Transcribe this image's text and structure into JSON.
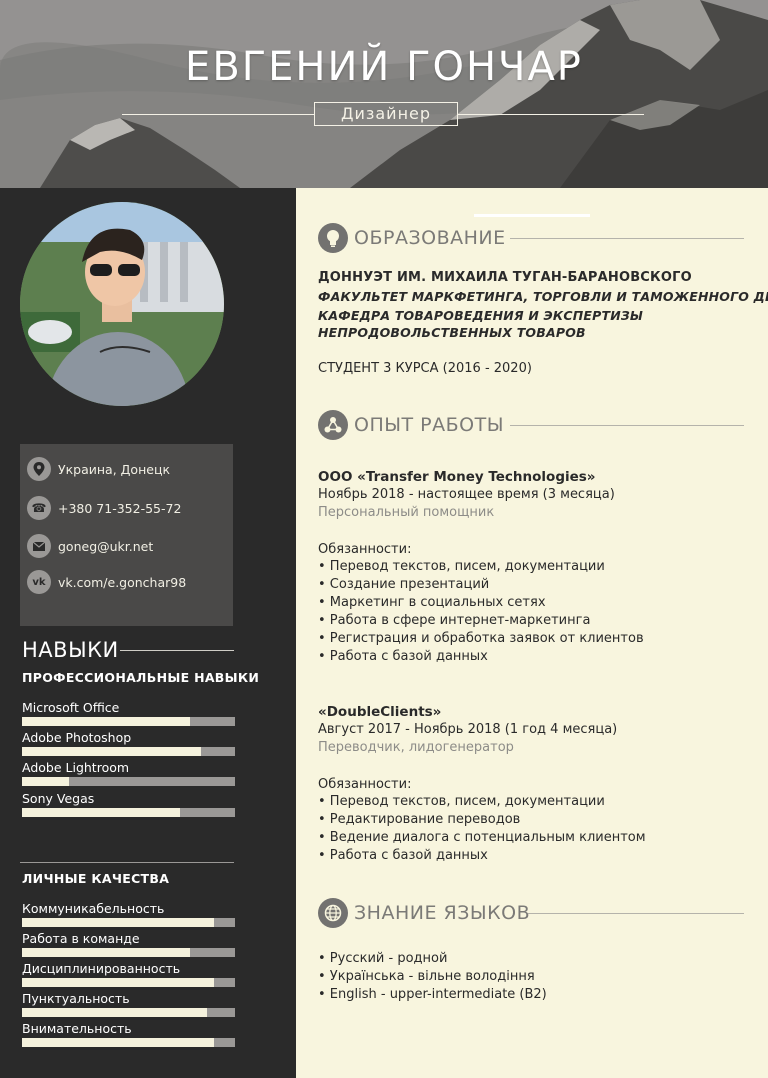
{
  "header": {
    "name": "ЕВГЕНИЙ ГОНЧАР",
    "role": "Дизайнер"
  },
  "contacts": [
    {
      "icon": "location-pin-icon",
      "text": "Украина, Донецк"
    },
    {
      "icon": "phone-icon",
      "text": "+380 71-352-55-72"
    },
    {
      "icon": "mail-icon",
      "text": "goneg@ukr.net"
    },
    {
      "icon": "vk-icon",
      "text": "vk.com/e.gonchar98"
    }
  ],
  "skills": {
    "title": "НАВЫКИ",
    "professional_title": "ПРОФЕССИОНАЛЬНЫЕ НАВЫКИ",
    "professional": [
      {
        "label": "Microsoft Office",
        "level": 0.79
      },
      {
        "label": "Adobe Photoshop",
        "level": 0.84
      },
      {
        "label": "Adobe Lightroom",
        "level": 0.22
      },
      {
        "label": "Sony Vegas",
        "level": 0.74
      }
    ],
    "personal_title": "ЛИЧНЫЕ КАЧЕСТВА",
    "personal": [
      {
        "label": "Коммуникабельность",
        "level": 0.9
      },
      {
        "label": "Работа в команде",
        "level": 0.79
      },
      {
        "label": "Дисциплинированность",
        "level": 0.9
      },
      {
        "label": "Пунктуальность",
        "level": 0.87
      },
      {
        "label": "Внимательность",
        "level": 0.9
      }
    ]
  },
  "education": {
    "title": "ОБРАЗОВАНИЕ",
    "university": "ДОННУЭТ ИМ. МИХАИЛА ТУГАН-БАРАНОВСКОГО",
    "faculty": "ФАКУЛЬТЕТ МАРКФЕТИНГА, ТОРГОВЛИ И ТАМОЖЕННОГО ДЕЛА",
    "department_line1": "КАФЕДРА ТОВАРОВЕДЕНИЯ И ЭКСПЕРТИЗЫ",
    "department_line2": "НЕПРОДОВОЛЬСТВЕННЫХ ТОВАРОВ",
    "status": "СТУДЕНТ 3 КУРСА (2016 - 2020)"
  },
  "experience": {
    "title": "ОПЫТ РАБОТЫ",
    "jobs": [
      {
        "company": "ООО «Transfer Money Technologies»",
        "period": "Ноябрь 2018 - настоящее время (3 месяца)",
        "position": "Персональный помощник",
        "duties_title": "Обязанности:",
        "duties": [
          "• Перевод текстов, писем, документации",
          "• Создание презентаций",
          "• Маркетинг в социальных сетях",
          "• Работа в сфере интернет-маркетинга",
          "• Регистрация и обработка заявок от клиентов",
          "• Работа с базой данных"
        ]
      },
      {
        "company": "«DoubleClients»",
        "period": "Август 2017 - Ноябрь 2018 (1 год 4 месяца)",
        "position": "Переводчик, лидогенератор",
        "duties_title": "Обязанности:",
        "duties": [
          "• Перевод текстов, писем, документации",
          "• Редактирование переводов",
          "• Ведение диалога с потенциальным клиентом",
          "• Работа с базой данных"
        ]
      }
    ]
  },
  "languages": {
    "title": "ЗНАНИЕ ЯЗЫКОВ",
    "items": [
      "• Русский - родной",
      "• Українська - вільне володіння",
      "• English - upper-intermediate (B2)"
    ]
  }
}
